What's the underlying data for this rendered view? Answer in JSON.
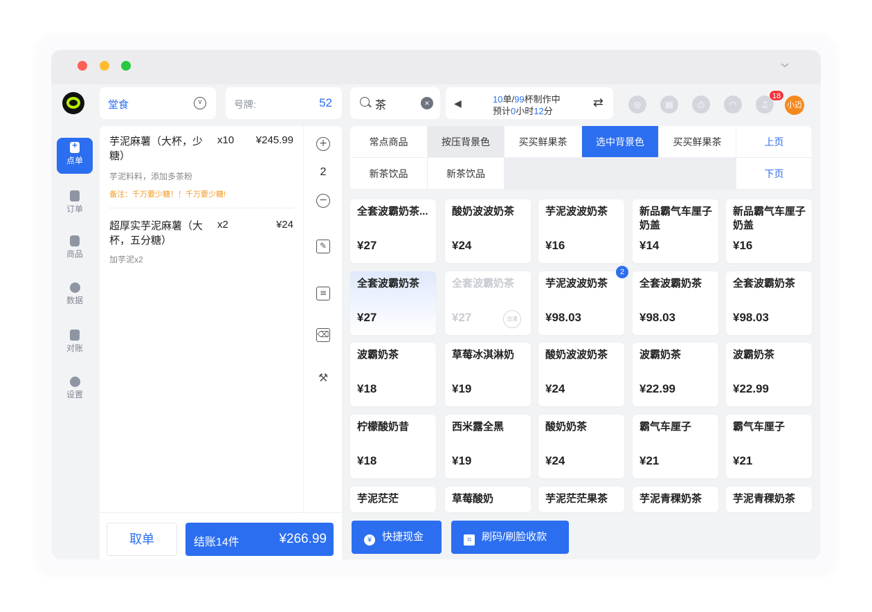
{
  "window": {
    "collapse_icon": "chevron-down-icon"
  },
  "sidebar": {
    "items": [
      {
        "label": "点单",
        "icon": "add-order-icon",
        "active": true
      },
      {
        "label": "订单",
        "icon": "document-icon",
        "active": false
      },
      {
        "label": "商品",
        "icon": "product-icon",
        "active": false
      },
      {
        "label": "数据",
        "icon": "pie-chart-icon",
        "active": false
      },
      {
        "label": "对账",
        "icon": "yuan-document-icon",
        "active": false
      },
      {
        "label": "设置",
        "icon": "gear-icon",
        "active": false
      }
    ]
  },
  "header": {
    "mode": "堂食",
    "number_label": "号牌:",
    "number_value": "52",
    "search_value": "茶",
    "status": {
      "orders": "10",
      "orders_unit": "单/",
      "cups": "99",
      "cups_suffix": "杯制作中",
      "eta_prefix": "预计",
      "eta_hours": "0",
      "eta_mid": "小时",
      "eta_minutes": "12",
      "eta_suffix": "分"
    },
    "notification_count": "18",
    "user_name": "小迈"
  },
  "order": {
    "items": [
      {
        "name": "芋泥麻薯（大杯，少糖）",
        "qty": "x10",
        "price": "¥245.99",
        "detail": "芋泥料料，添加多茶粉",
        "note": "备注：千万要少糖！！千万要少糖!"
      },
      {
        "name": "超厚实芋泥麻薯（大杯，五分糖）",
        "qty": "x2",
        "price": "¥24",
        "detail": "加芋泥x2",
        "note": ""
      }
    ],
    "selected_qty": "2",
    "cancel_label": "取单",
    "checkout_label": "结账14件",
    "checkout_total": "¥266.99"
  },
  "payment": {
    "cash_label": "快捷现金",
    "scan_label": "刷码/刷脸收款"
  },
  "categories": {
    "row1": [
      "常点商品",
      "按压背景色",
      "买买鲜果茶",
      "选中背景色",
      "买买鲜果茶"
    ],
    "row2": [
      "新茶饮品",
      "新茶饮品",
      "",
      "",
      ""
    ],
    "prev_label": "上页",
    "next_label": "下页"
  },
  "products": [
    {
      "name": "全套波霸奶茶...",
      "price": "¥27"
    },
    {
      "name": "酸奶波波奶茶",
      "price": "¥24"
    },
    {
      "name": "芋泥波波奶茶",
      "price": "¥16"
    },
    {
      "name": "新品霸气车厘子奶盖",
      "price": "¥14"
    },
    {
      "name": "新品霸气车厘子奶盖",
      "price": "¥16"
    },
    {
      "name": "全套波霸奶茶",
      "price": "¥27",
      "highlight": true
    },
    {
      "name": "全套波霸奶茶",
      "price": "¥27",
      "disabled": true,
      "stamp": "沽清"
    },
    {
      "name": "芋泥波波奶茶",
      "price": "¥98.03",
      "badge": "2"
    },
    {
      "name": "全套波霸奶茶",
      "price": "¥98.03"
    },
    {
      "name": "全套波霸奶茶",
      "price": "¥98.03"
    },
    {
      "name": "波霸奶茶",
      "price": "¥18"
    },
    {
      "name": "草莓冰淇淋奶",
      "price": "¥19"
    },
    {
      "name": "酸奶波波奶茶",
      "price": "¥24"
    },
    {
      "name": "波霸奶茶",
      "price": "¥22.99"
    },
    {
      "name": "波霸奶茶",
      "price": "¥22.99"
    },
    {
      "name": "柠檬酸奶昔",
      "price": "¥18"
    },
    {
      "name": "西米露全黑",
      "price": "¥19"
    },
    {
      "name": "酸奶奶茶",
      "price": "¥24"
    },
    {
      "name": "霸气车厘子",
      "price": "¥21"
    },
    {
      "name": "霸气车厘子",
      "price": "¥21"
    },
    {
      "name": "芋泥茫茫",
      "price": ""
    },
    {
      "name": "草莓酸奶",
      "price": ""
    },
    {
      "name": "芋泥茫茫果茶",
      "price": ""
    },
    {
      "name": "芋泥青稞奶茶",
      "price": ""
    },
    {
      "name": "芋泥青稞奶茶",
      "price": ""
    }
  ]
}
